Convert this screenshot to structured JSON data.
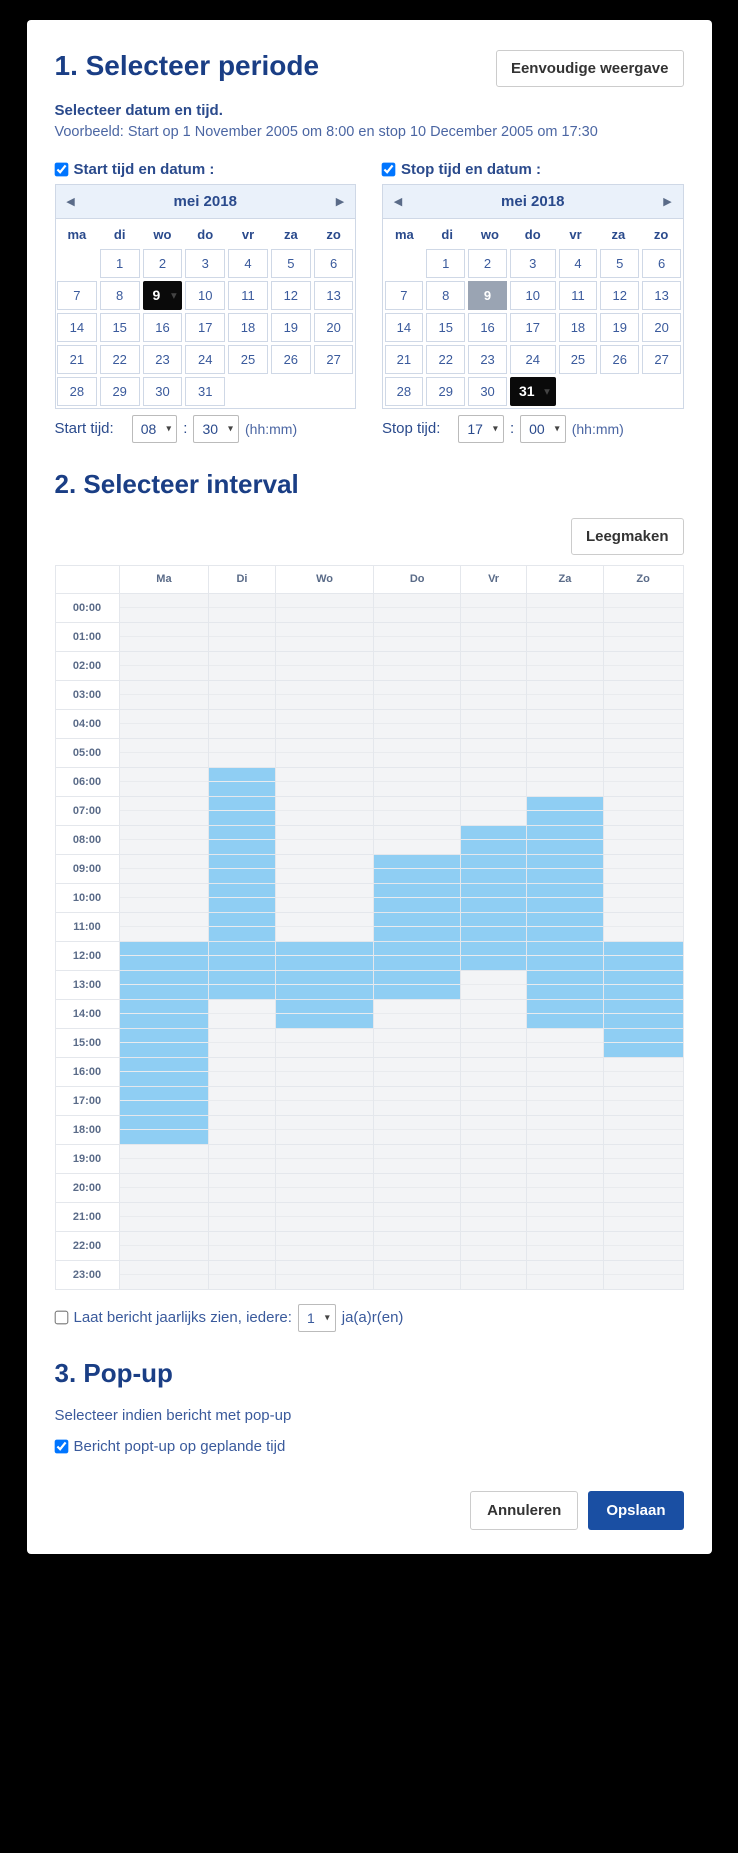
{
  "section1": {
    "title": "1. Selecteer periode",
    "simple_btn": "Eenvoudige weergave",
    "subhead": "Selecteer datum en tijd.",
    "example": "Voorbeeld: Start op 1 November 2005 om 8:00 en stop 10 December 2005 om 17:30"
  },
  "start_cal": {
    "check_label": "Start tijd en datum :",
    "checked": true,
    "month": "mei 2018",
    "dow": [
      "ma",
      "di",
      "wo",
      "do",
      "vr",
      "za",
      "zo"
    ],
    "lead_blank": 1,
    "days": 31,
    "selected": 9,
    "today": null,
    "time_label": "Start tijd:",
    "hh": "08",
    "mm": "30",
    "hint": "(hh:mm)"
  },
  "stop_cal": {
    "check_label": "Stop tijd en datum :",
    "checked": true,
    "month": "mei 2018",
    "dow": [
      "ma",
      "di",
      "wo",
      "do",
      "vr",
      "za",
      "zo"
    ],
    "lead_blank": 1,
    "days": 31,
    "selected": 31,
    "today": 9,
    "time_label": "Stop tijd:",
    "hh": "17",
    "mm": "00",
    "hint": "(hh:mm)"
  },
  "section2": {
    "title": "2. Selecteer interval",
    "clear_btn": "Leegmaken",
    "days": [
      "Ma",
      "Di",
      "Wo",
      "Do",
      "Vr",
      "Za",
      "Zo"
    ],
    "hours": [
      "00:00",
      "01:00",
      "02:00",
      "03:00",
      "04:00",
      "05:00",
      "06:00",
      "07:00",
      "08:00",
      "09:00",
      "10:00",
      "11:00",
      "12:00",
      "13:00",
      "14:00",
      "15:00",
      "16:00",
      "17:00",
      "18:00",
      "19:00",
      "20:00",
      "21:00",
      "22:00",
      "23:00"
    ],
    "on_ranges": {
      "Ma": [
        12,
        18
      ],
      "Di": [
        6,
        13
      ],
      "Wo": [
        12,
        14
      ],
      "Do": [
        9,
        13
      ],
      "Vr": [
        8,
        12
      ],
      "Za": [
        7,
        14
      ],
      "Zo": [
        12,
        15
      ]
    }
  },
  "yearly": {
    "checked": false,
    "label_before": "Laat bericht jaarlijks zien, iedere:",
    "value": "1",
    "label_after": "ja(a)r(en)"
  },
  "section3": {
    "title": "3. Pop-up",
    "desc": "Selecteer indien bericht met pop-up",
    "check_label": "Bericht popt-up op geplande tijd",
    "checked": true
  },
  "footer": {
    "cancel": "Annuleren",
    "save": "Opslaan"
  }
}
